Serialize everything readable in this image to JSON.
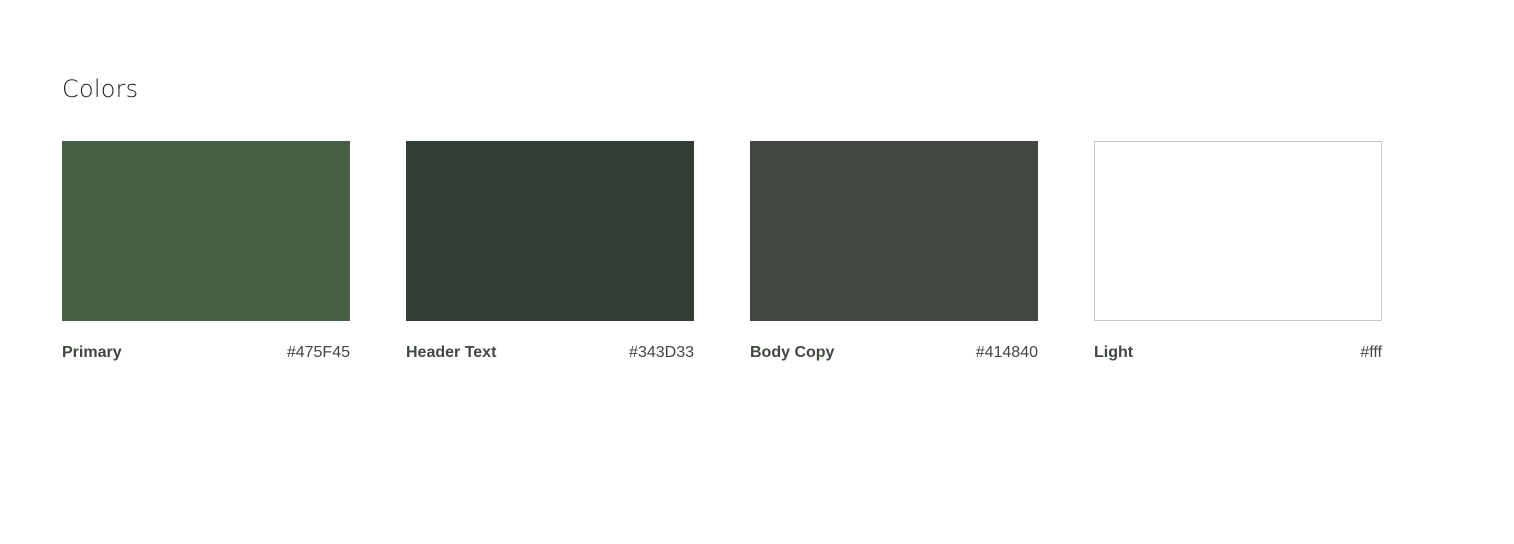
{
  "page": {
    "title": "Colors"
  },
  "swatches": [
    {
      "name": "Primary",
      "hex_label": "#475F45",
      "color": "#475F45",
      "bordered": false
    },
    {
      "name": "Header Text",
      "hex_label": "#343D33",
      "color": "#343D33",
      "bordered": false
    },
    {
      "name": "Body Copy",
      "hex_label": "#414840",
      "color": "#414840",
      "bordered": false
    },
    {
      "name": "Light",
      "hex_label": "#fff",
      "color": "#ffffff",
      "bordered": true
    }
  ]
}
